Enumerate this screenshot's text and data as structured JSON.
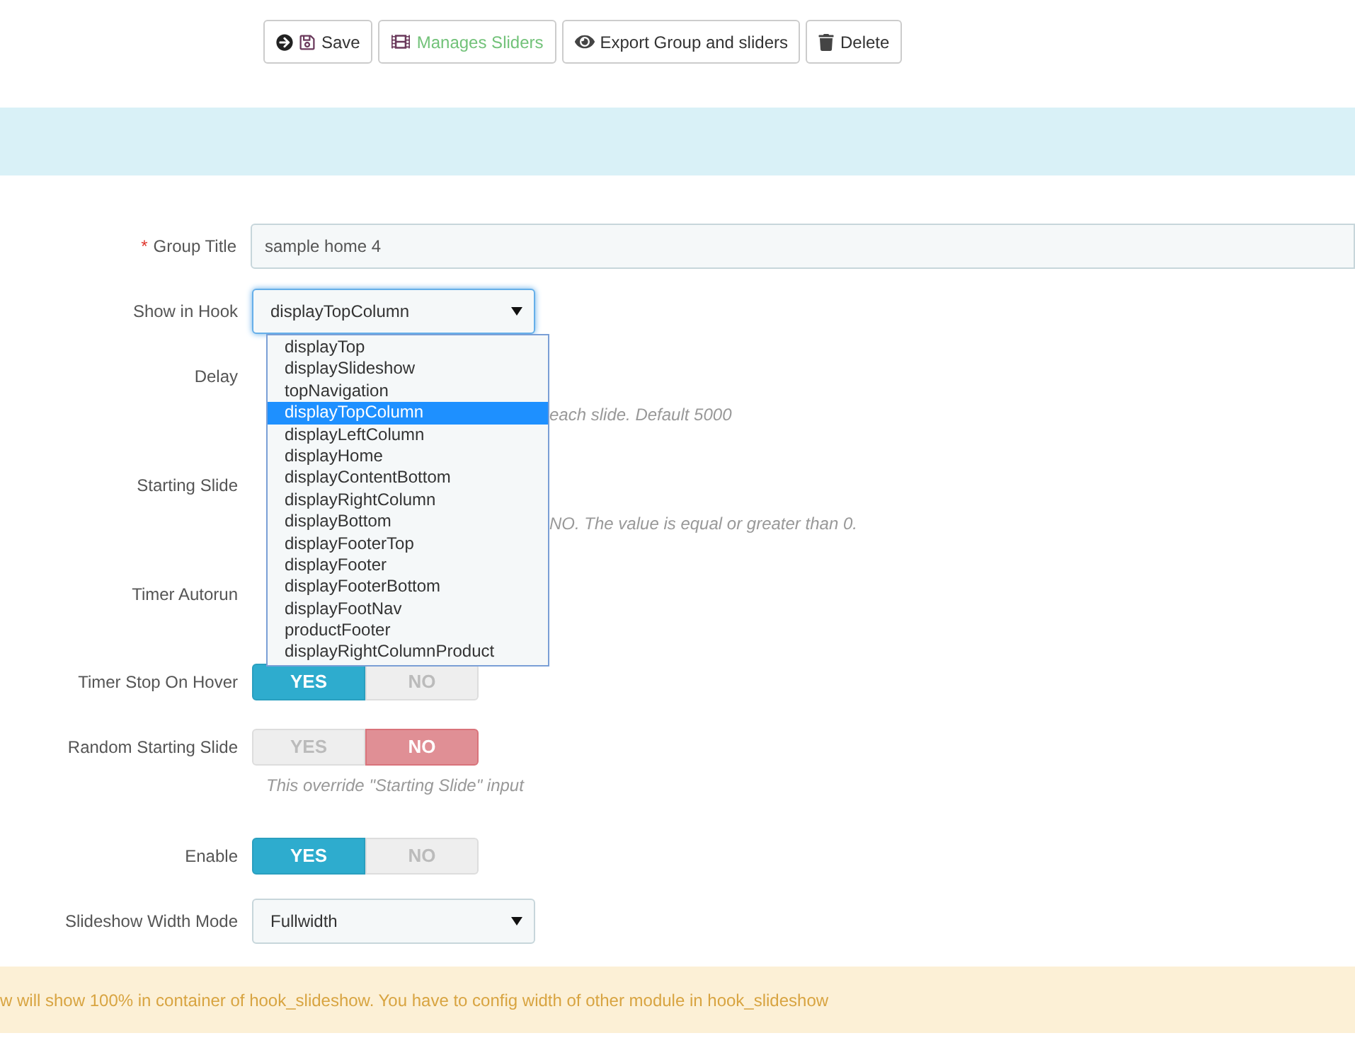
{
  "toolbar": [
    {
      "kind": "save",
      "label": "Save"
    },
    {
      "kind": "sliders",
      "label": "Manages Sliders"
    },
    {
      "kind": "export",
      "label": "Export Group and sliders"
    },
    {
      "kind": "delete",
      "label": "Delete"
    }
  ],
  "fields": [
    {
      "kind": "text",
      "label": "Group Title",
      "required_mark": "*",
      "value": "sample home 4"
    },
    {
      "kind": "select",
      "label": "Show in Hook",
      "value": "displayTopColumn",
      "open": true,
      "options": [
        {
          "label": "displayTop",
          "selected": false
        },
        {
          "label": "displaySlideshow",
          "selected": false
        },
        {
          "label": "topNavigation",
          "selected": false
        },
        {
          "label": "displayTopColumn",
          "selected": true
        },
        {
          "label": "displayLeftColumn",
          "selected": false
        },
        {
          "label": "displayHome",
          "selected": false
        },
        {
          "label": "displayContentBottom",
          "selected": false
        },
        {
          "label": "displayRightColumn",
          "selected": false
        },
        {
          "label": "displayBottom",
          "selected": false
        },
        {
          "label": "displayFooterTop",
          "selected": false
        },
        {
          "label": "displayFooter",
          "selected": false
        },
        {
          "label": "displayFooterBottom",
          "selected": false
        },
        {
          "label": "displayFootNav",
          "selected": false
        },
        {
          "label": "productFooter",
          "selected": false
        },
        {
          "label": "displayRightColumnProduct",
          "selected": false
        }
      ]
    },
    {
      "kind": "covered",
      "label": "Delay",
      "help": "each slide. Default 5000"
    },
    {
      "kind": "covered",
      "label": "Starting Slide",
      "help": "NO. The value is equal or greater than 0."
    },
    {
      "kind": "covered",
      "label": "Timer Autorun"
    },
    {
      "kind": "toggle",
      "label": "Timer Stop On Hover",
      "on": true,
      "yes": "YES",
      "no": "NO"
    },
    {
      "kind": "toggle",
      "label": "Random Starting Slide",
      "on": false,
      "yes": "YES",
      "no": "NO",
      "help": "This override \"Starting Slide\" input"
    },
    {
      "kind": "toggle",
      "label": "Enable",
      "on": true,
      "yes": "YES",
      "no": "NO"
    },
    {
      "kind": "select",
      "label": "Slideshow Width Mode",
      "value": "Fullwidth",
      "open": false
    }
  ],
  "alert": "w will show 100% in container of hook_slideshow. You have to config width of other module in hook_slideshow"
}
